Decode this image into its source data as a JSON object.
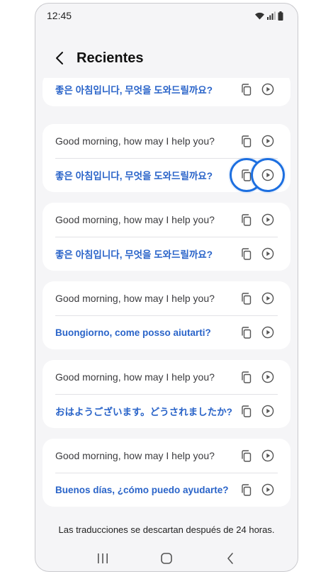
{
  "status_bar": {
    "time": "12:45"
  },
  "header": {
    "title": "Recientes"
  },
  "cards": [
    {
      "rows": [
        {
          "kind": "translated",
          "text": "좋은 아침입니다, 무엇을 도와드릴까요?"
        }
      ]
    },
    {
      "rows": [
        {
          "kind": "source",
          "text": "Good morning, how may I help you?"
        },
        {
          "kind": "translated",
          "text": "좋은 아침입니다, 무엇을 도와드릴까요?",
          "highlighted": true
        }
      ]
    },
    {
      "rows": [
        {
          "kind": "source",
          "text": "Good morning, how may I help you?"
        },
        {
          "kind": "translated",
          "text": "좋은 아침입니다, 무엇을 도와드릴까요?"
        }
      ]
    },
    {
      "rows": [
        {
          "kind": "source",
          "text": "Good morning, how may I help you?"
        },
        {
          "kind": "translated",
          "text": "Buongiorno, come posso aiutarti?"
        }
      ]
    },
    {
      "rows": [
        {
          "kind": "source",
          "text": "Good morning, how may I help you?"
        },
        {
          "kind": "translated",
          "text": "おはようございます。どうされましたか?"
        }
      ]
    },
    {
      "rows": [
        {
          "kind": "source",
          "text": "Good morning, how may I help you?"
        },
        {
          "kind": "translated",
          "text": "Buenos días, ¿cómo puedo ayudarte?"
        }
      ]
    }
  ],
  "footer": {
    "note": "Las traducciones se descartan después de 24 horas."
  },
  "colors": {
    "accent": "#2a64c9",
    "highlight_ring": "#1d6fe0",
    "background": "#f5f5f7",
    "card": "#ffffff"
  },
  "icons": {
    "copy": "copy-icon",
    "play": "play-icon",
    "back": "back-arrow-icon"
  }
}
